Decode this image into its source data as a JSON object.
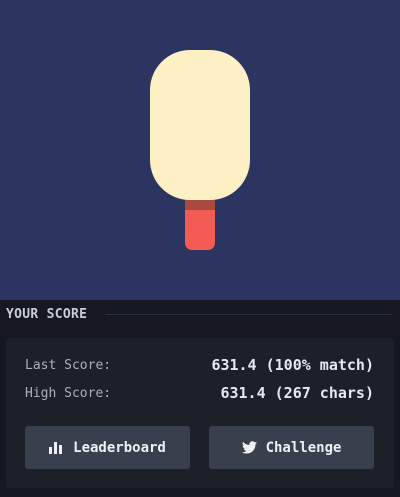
{
  "canvas": {
    "background": "#2c3561",
    "popsicle_color": "#fdf0c5",
    "stick_shadow_color": "#a94a3e",
    "stick_color": "#f25c54"
  },
  "score_panel": {
    "section_title": "YOUR SCORE",
    "last_score_label": "Last Score:",
    "last_score_value": "631.4 (100% match)",
    "high_score_label": "High Score:",
    "high_score_value": "631.4 (267 chars)",
    "leaderboard_button": {
      "label": "Leaderboard",
      "icon": "bar-chart-icon"
    },
    "challenge_button": {
      "label": "Challenge",
      "icon": "twitter-icon"
    }
  }
}
